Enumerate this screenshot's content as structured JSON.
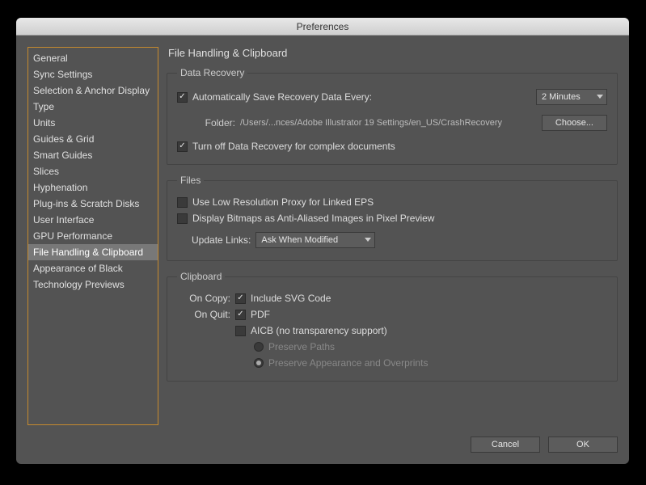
{
  "titlebar": {
    "title": "Preferences"
  },
  "sidebar": {
    "items": [
      {
        "label": "General",
        "selected": false
      },
      {
        "label": "Sync Settings",
        "selected": false
      },
      {
        "label": "Selection & Anchor Display",
        "selected": false
      },
      {
        "label": "Type",
        "selected": false
      },
      {
        "label": "Units",
        "selected": false
      },
      {
        "label": "Guides & Grid",
        "selected": false
      },
      {
        "label": "Smart Guides",
        "selected": false
      },
      {
        "label": "Slices",
        "selected": false
      },
      {
        "label": "Hyphenation",
        "selected": false
      },
      {
        "label": "Plug-ins & Scratch Disks",
        "selected": false
      },
      {
        "label": "User Interface",
        "selected": false
      },
      {
        "label": "GPU Performance",
        "selected": false
      },
      {
        "label": "File Handling & Clipboard",
        "selected": true
      },
      {
        "label": "Appearance of Black",
        "selected": false
      },
      {
        "label": "Technology Previews",
        "selected": false
      }
    ]
  },
  "page": {
    "title": "File Handling & Clipboard"
  },
  "dataRecovery": {
    "legend": "Data Recovery",
    "autoSave": {
      "checked": true,
      "label": "Automatically Save Recovery Data Every:"
    },
    "interval": {
      "value": "2 Minutes"
    },
    "folderLabel": "Folder:",
    "folderPath": "/Users/...nces/Adobe Illustrator 19 Settings/en_US/CrashRecovery",
    "chooseLabel": "Choose...",
    "turnOff": {
      "checked": true,
      "label": "Turn off Data Recovery for complex documents"
    }
  },
  "files": {
    "legend": "Files",
    "lowRes": {
      "checked": false,
      "label": "Use Low Resolution Proxy for Linked EPS"
    },
    "bitmaps": {
      "checked": false,
      "label": "Display Bitmaps as Anti-Aliased Images in Pixel Preview"
    },
    "updateLinksLabel": "Update Links:",
    "updateLinksValue": "Ask When Modified"
  },
  "clipboard": {
    "legend": "Clipboard",
    "onCopyLabel": "On Copy:",
    "onQuitLabel": "On Quit:",
    "svg": {
      "checked": true,
      "label": "Include SVG Code"
    },
    "pdf": {
      "checked": true,
      "label": "PDF"
    },
    "aicb": {
      "checked": false,
      "label": "AICB (no transparency support)"
    },
    "preservePaths": {
      "selected": false,
      "label": "Preserve Paths"
    },
    "preserveAppearance": {
      "selected": true,
      "label": "Preserve Appearance and Overprints"
    }
  },
  "footer": {
    "cancel": "Cancel",
    "ok": "OK"
  }
}
